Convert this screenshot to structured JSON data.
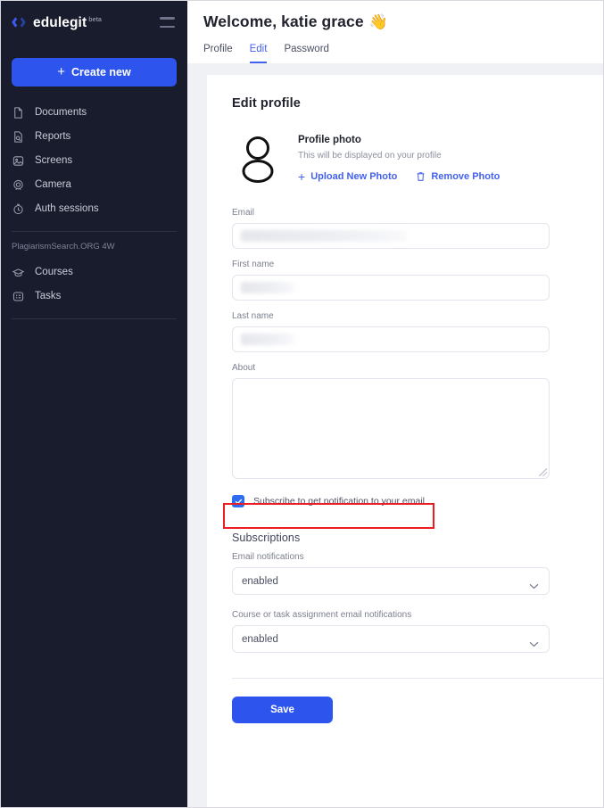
{
  "sidebar": {
    "brand": {
      "name": "edulegit",
      "tag": "beta",
      "logo_icon": "edulegit-diamond-logo"
    },
    "menu_icon": "hamburger-menu-icon",
    "create_button": {
      "label": "Create new",
      "icon": "plus-icon"
    },
    "items": [
      {
        "label": "Documents",
        "icon": "document-icon"
      },
      {
        "label": "Reports",
        "icon": "report-search-icon"
      },
      {
        "label": "Screens",
        "icon": "screen-image-icon"
      },
      {
        "label": "Camera",
        "icon": "camera-icon"
      },
      {
        "label": "Auth sessions",
        "icon": "clock-icon"
      }
    ],
    "section_title": "PlagiarismSearch.ORG 4W",
    "section_items": [
      {
        "label": "Courses",
        "icon": "graduation-cap-icon"
      },
      {
        "label": "Tasks",
        "icon": "tasks-list-icon"
      }
    ]
  },
  "header": {
    "welcome": "Welcome, katie grace",
    "wave_emoji": "👋",
    "tabs": [
      {
        "label": "Profile",
        "active": false
      },
      {
        "label": "Edit",
        "active": true
      },
      {
        "label": "Password",
        "active": false
      }
    ]
  },
  "edit_profile": {
    "title": "Edit profile",
    "photo": {
      "avatar_icon": "user-avatar-icon",
      "title": "Profile photo",
      "subtitle": "This will be displayed on your profile",
      "upload_label": "Upload New Photo",
      "upload_icon": "plus-icon",
      "remove_label": "Remove Photo",
      "remove_icon": "trash-icon"
    },
    "fields": [
      {
        "label": "Email",
        "value": "",
        "redacted": true
      },
      {
        "label": "First name",
        "value": "",
        "redacted": true
      },
      {
        "label": "Last name",
        "value": "",
        "redacted": true
      }
    ],
    "about": {
      "label": "About",
      "value": "",
      "placeholder": ""
    },
    "subscribe_checkbox": {
      "label": "Subscribe to get notification to your email",
      "checked": true,
      "highlighted": true,
      "highlight_color": "#ec1c24"
    },
    "subscriptions": {
      "title": "Subscriptions",
      "selects": [
        {
          "label": "Email notifications",
          "value": "enabled",
          "chevron_icon": "chevron-down-icon"
        },
        {
          "label": "Course or task assignment email notifications",
          "value": "enabled",
          "chevron_icon": "chevron-down-icon"
        }
      ]
    },
    "save_label": "Save"
  },
  "colors": {
    "accent_blue": "#2d55ee",
    "link_blue": "#4361ee",
    "sidebar_bg": "#191c2c",
    "page_bg": "#f0f1f5",
    "highlight_red": "#ec1c24",
    "checkbox_blue": "#2d6ef0"
  }
}
